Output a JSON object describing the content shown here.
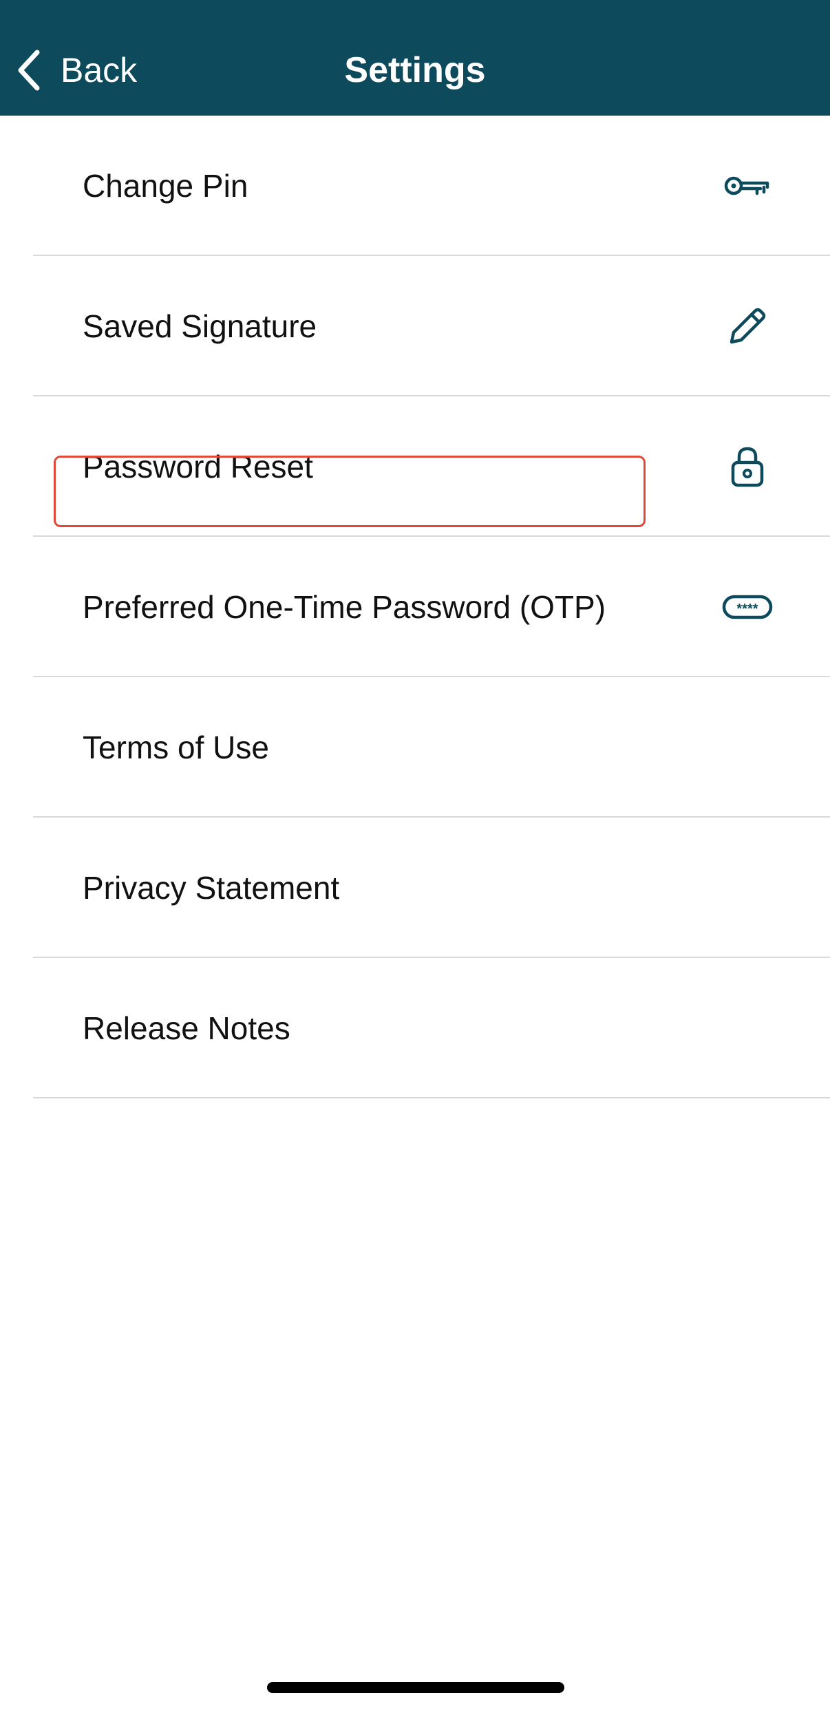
{
  "navbar": {
    "back_label": "Back",
    "title": "Settings"
  },
  "settings": {
    "items": [
      {
        "label": "Change Pin",
        "icon": "key-icon"
      },
      {
        "label": "Saved Signature",
        "icon": "pencil-icon"
      },
      {
        "label": "Password Reset",
        "icon": "lock-icon"
      },
      {
        "label": "Preferred One-Time Password (OTP)",
        "icon": "password-field-icon",
        "icon_text": "****",
        "highlighted": true
      },
      {
        "label": "Terms of Use"
      },
      {
        "label": "Privacy Statement"
      },
      {
        "label": "Release Notes"
      }
    ]
  },
  "colors": {
    "navbar": "#0d4a5c",
    "icon": "#0d4a5c",
    "divider": "#d9d9d9",
    "highlight": "#e0483a"
  }
}
